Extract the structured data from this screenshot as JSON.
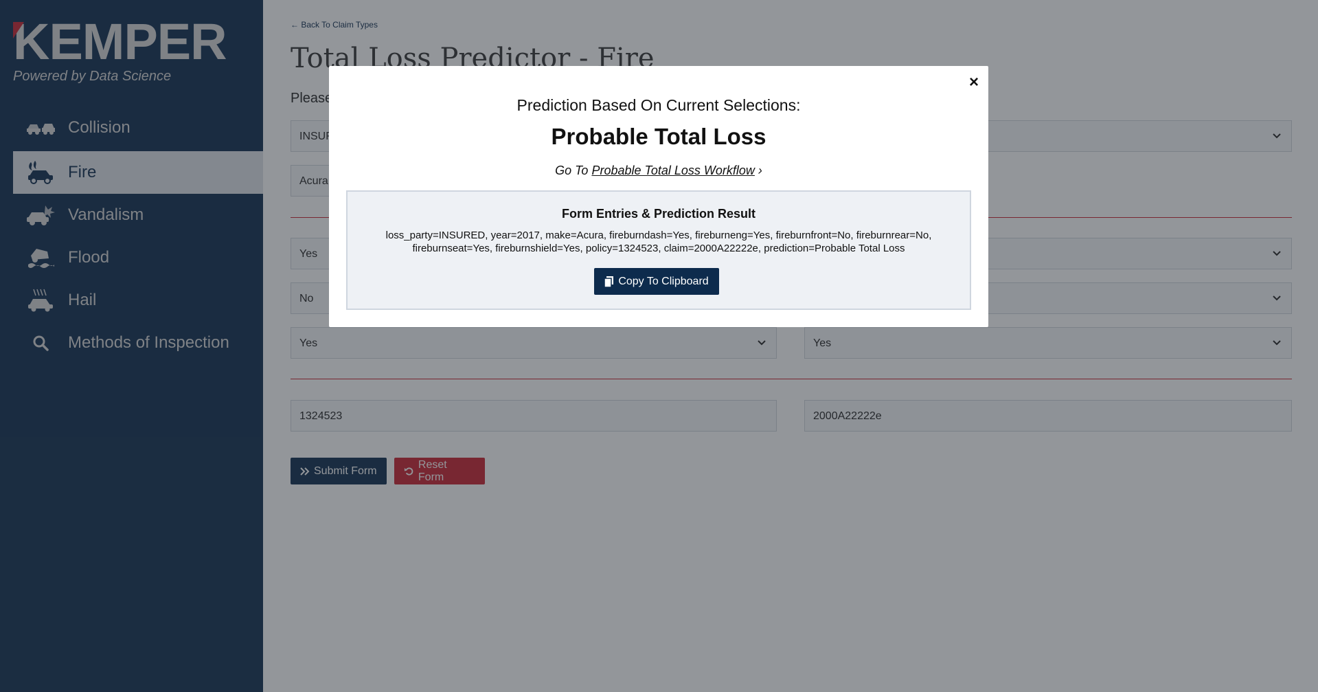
{
  "brand": {
    "name": "KEMPER",
    "tagline": "Powered by Data Science",
    "accent_color": "#c8202f",
    "navy_color": "#0d2b4d"
  },
  "sidebar": {
    "items": [
      {
        "label": "Collision",
        "icon": "car-collision-icon",
        "active": false
      },
      {
        "label": "Fire",
        "icon": "car-fire-icon",
        "active": true
      },
      {
        "label": "Vandalism",
        "icon": "car-vandalism-icon",
        "active": false
      },
      {
        "label": "Flood",
        "icon": "car-flood-icon",
        "active": false
      },
      {
        "label": "Hail",
        "icon": "car-hail-icon",
        "active": false
      },
      {
        "label": "Methods of Inspection",
        "icon": "search-icon",
        "active": false
      }
    ]
  },
  "main": {
    "back_label": "Back To Claim Types",
    "title": "Total Loss Predictor - Fire",
    "please_text": "Please",
    "fields": {
      "loss_party": "INSUR",
      "make": "Acura",
      "row3_left": "Yes",
      "row4_left": "No",
      "row5_left": "Yes",
      "row5_right": "Yes",
      "policy": "1324523",
      "claim": "2000A22222e"
    },
    "submit_label": "Submit Form",
    "reset_label": "Reset Form"
  },
  "modal": {
    "subtitle": "Prediction Based On Current Selections:",
    "title": "Probable Total Loss",
    "goto_prefix": "Go To",
    "goto_link": "Probable Total Loss Workflow",
    "goto_suffix": "›",
    "result_title": "Form Entries & Prediction Result",
    "result_text": "loss_party=INSURED, year=2017, make=Acura, fireburndash=Yes, fireburneng=Yes, fireburnfront=No, fireburnrear=No, fireburnseat=Yes, fireburnshield=Yes, policy=1324523, claim=2000A22222e, prediction=Probable Total Loss",
    "copy_label": "Copy To Clipboard",
    "close_symbol": "×"
  }
}
